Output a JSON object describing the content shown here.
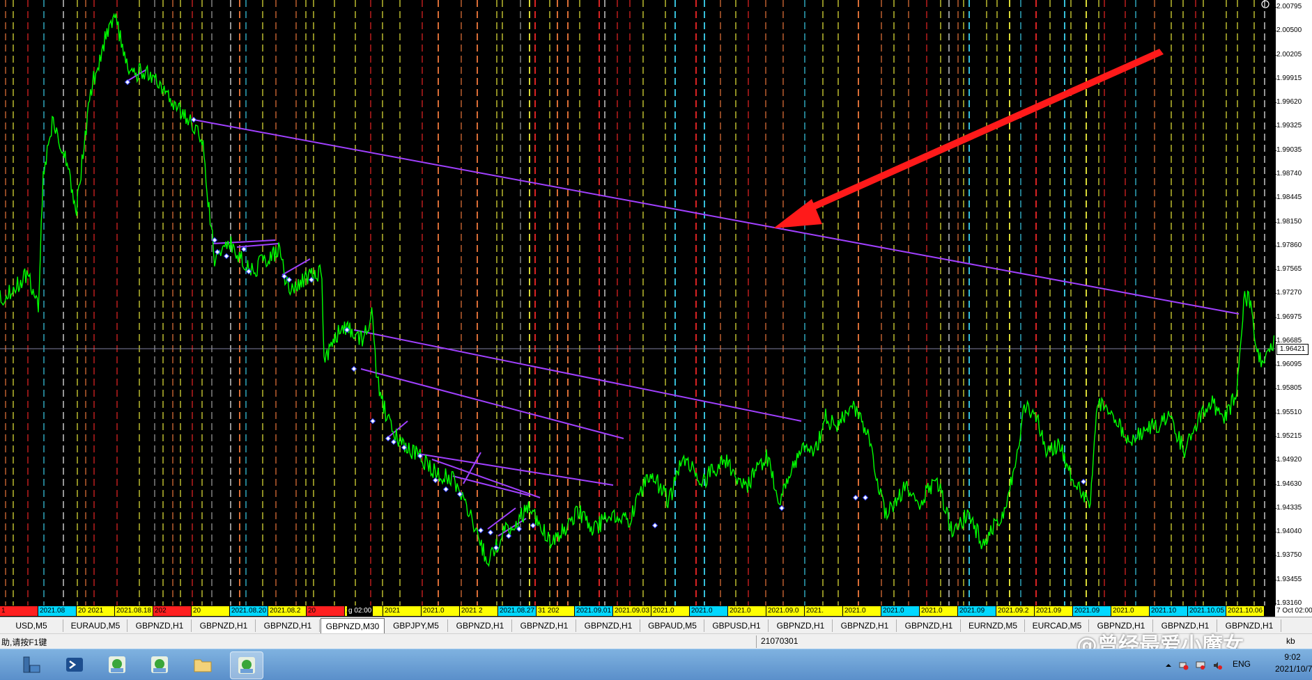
{
  "price_axis": {
    "ticks": [
      "2.00795",
      "2.00500",
      "2.00205",
      "1.99915",
      "1.99620",
      "1.99325",
      "1.99035",
      "1.98740",
      "1.98445",
      "1.98150",
      "1.97860",
      "1.97565",
      "1.97270",
      "1.96975",
      "1.96685",
      "1.96095",
      "1.95805",
      "1.95510",
      "1.95215",
      "1.94920",
      "1.94630",
      "1.94335",
      "1.94040",
      "1.93750",
      "1.93455",
      "1.93160"
    ],
    "current_price": "1.96421"
  },
  "time_axis": {
    "labels": [
      {
        "text": "1",
        "color": "#ff2020"
      },
      {
        "text": "2021.08",
        "color": "#00d8ff"
      },
      {
        "text": "20 2021",
        "color": "#ffff00"
      },
      {
        "text": "2021.08.18 1:",
        "color": "#ffff00"
      },
      {
        "text": "202",
        "color": "#ff2020"
      },
      {
        "text": "20",
        "color": "#ffff00"
      },
      {
        "text": "2021.08.20 16:5",
        "color": "#00d8ff"
      },
      {
        "text": "2021.08.2",
        "color": "#ffff00"
      },
      {
        "text": "20",
        "color": "#ff2020"
      },
      {
        "text": "2021.0",
        "color": "#ffff00"
      },
      {
        "text": "2021",
        "color": "#ffff00"
      },
      {
        "text": "2021.0",
        "color": "#ffff00"
      },
      {
        "text": "2021 2",
        "color": "#ffff00"
      },
      {
        "text": "2021.08.27 17:18",
        "color": "#00d8ff"
      },
      {
        "text": "31 202",
        "color": "#ffff00"
      },
      {
        "text": "2021.09.01 2",
        "color": "#00d8ff"
      },
      {
        "text": "2021.09.03 0",
        "color": "#ffff00"
      },
      {
        "text": "2021.0",
        "color": "#ffff00"
      },
      {
        "text": "2021.0",
        "color": "#00d8ff"
      },
      {
        "text": "2021.0",
        "color": "#ffff00"
      },
      {
        "text": "2021.09.0",
        "color": "#ffff00"
      },
      {
        "text": "2021.",
        "color": "#ffff00"
      },
      {
        "text": "2021.0",
        "color": "#ffff00"
      },
      {
        "text": "2021.0",
        "color": "#00d8ff"
      },
      {
        "text": "2021.0",
        "color": "#ffff00"
      },
      {
        "text": "2021.09",
        "color": "#00d8ff"
      },
      {
        "text": "2021.09.2",
        "color": "#ffff00"
      },
      {
        "text": "2021.09",
        "color": "#ffff00"
      },
      {
        "text": "2021.09",
        "color": "#00d8ff"
      },
      {
        "text": "2021.0",
        "color": "#ffff00"
      },
      {
        "text": "2021.10",
        "color": "#00d8ff"
      },
      {
        "text": "2021.10.05",
        "color": "#00d8ff"
      },
      {
        "text": "2021.10.06 04:32",
        "color": "#ffff00"
      }
    ],
    "right_label": "7 Oct 02:00",
    "inline_label": "g 02:00"
  },
  "tabs": [
    {
      "label": "USD,M5",
      "active": false
    },
    {
      "label": "EURAUD,M5",
      "active": false
    },
    {
      "label": "GBPNZD,H1",
      "active": false
    },
    {
      "label": "GBPNZD,H1",
      "active": false
    },
    {
      "label": "GBPNZD,H1",
      "active": false
    },
    {
      "label": "GBPNZD,M30",
      "active": true
    },
    {
      "label": "GBPJPY,M5",
      "active": false
    },
    {
      "label": "GBPNZD,H1",
      "active": false
    },
    {
      "label": "GBPNZD,H1",
      "active": false
    },
    {
      "label": "GBPNZD,H1",
      "active": false
    },
    {
      "label": "GBPAUD,M5",
      "active": false
    },
    {
      "label": "GBPUSD,H1",
      "active": false
    },
    {
      "label": "GBPNZD,H1",
      "active": false
    },
    {
      "label": "GBPNZD,H1",
      "active": false
    },
    {
      "label": "GBPNZD,H1",
      "active": false
    },
    {
      "label": "EURNZD,M5",
      "active": false
    },
    {
      "label": "EURCAD,M5",
      "active": false
    },
    {
      "label": "GBPNZD,H1",
      "active": false
    },
    {
      "label": "GBPNZD,H1",
      "active": false
    },
    {
      "label": "GBPNZD,H1",
      "active": false
    }
  ],
  "status_bar": {
    "help_text": "助,请按F1键",
    "server_text": "21070301",
    "right_text": "kb"
  },
  "watermark": "@曾经最爱小魔女",
  "taskbar": {
    "language": "ENG",
    "time": "9:02",
    "date": "2021/10/7"
  },
  "colors": {
    "price_line": "#00ff00",
    "trend_line": "#a040ff",
    "arrow": "#ff1a1a",
    "vline_red": "#ff2a2a",
    "vline_yellow": "#ffff40",
    "vline_cyan": "#40e0ff",
    "vline_orange": "#ff8040",
    "vline_gray": "#b0b0b0"
  }
}
